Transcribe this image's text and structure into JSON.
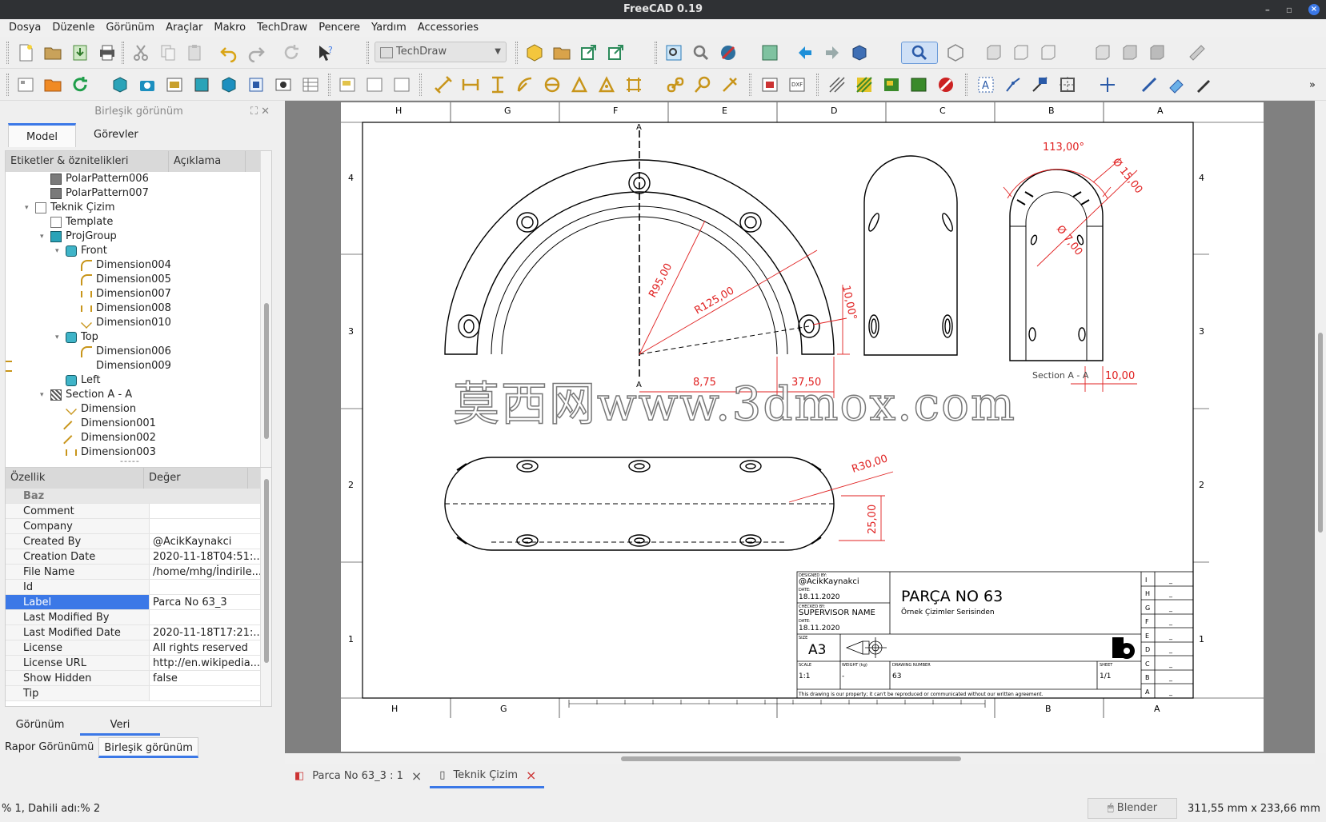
{
  "window": {
    "title": "FreeCAD 0.19"
  },
  "menu": [
    "Dosya",
    "Düzenle",
    "Görünüm",
    "Araçlar",
    "Makro",
    "TechDraw",
    "Pencere",
    "Yardım",
    "Accessories"
  ],
  "toolbar": {
    "workbench": "TechDraw"
  },
  "combo": {
    "title": "Birleşik görünüm",
    "tabs": [
      "Model",
      "Görevler"
    ],
    "tree_headers": [
      "Etiketler & öznitelikleri",
      "Açıklama"
    ],
    "tree": [
      {
        "label": "PolarPattern006",
        "icon": "pattern-icon"
      },
      {
        "label": "PolarPattern007",
        "icon": "pattern-icon"
      },
      {
        "label": "Teknik Çizim",
        "icon": "page-icon"
      },
      {
        "label": "Template",
        "icon": "template-icon"
      },
      {
        "label": "ProjGroup",
        "icon": "projgroup-icon"
      },
      {
        "label": "Front",
        "icon": "view-icon"
      },
      {
        "label": "Dimension004",
        "icon": "radius-dimension-icon"
      },
      {
        "label": "Dimension005",
        "icon": "radius-dimension-icon"
      },
      {
        "label": "Dimension007",
        "icon": "horizontal-dimension-icon"
      },
      {
        "label": "Dimension008",
        "icon": "horizontal-dimension-icon"
      },
      {
        "label": "Dimension010",
        "icon": "angle-dimension-icon"
      },
      {
        "label": "Top",
        "icon": "view-icon"
      },
      {
        "label": "Dimension006",
        "icon": "radius-dimension-icon"
      },
      {
        "label": "Dimension009",
        "icon": "vertical-dimension-icon"
      },
      {
        "label": "Left",
        "icon": "view-icon"
      },
      {
        "label": "Section A - A",
        "icon": "section-icon"
      },
      {
        "label": "Dimension",
        "icon": "angle-dimension-icon"
      },
      {
        "label": "Dimension001",
        "icon": "length-dimension-icon"
      },
      {
        "label": "Dimension002",
        "icon": "length-dimension-icon"
      },
      {
        "label": "Dimension003",
        "icon": "horizontal-dimension-icon"
      }
    ],
    "prop_headers": [
      "Özellik",
      "Değer"
    ],
    "prop_group": "Baz",
    "properties": [
      {
        "key": "Comment",
        "value": ""
      },
      {
        "key": "Company",
        "value": ""
      },
      {
        "key": "Created By",
        "value": "@AcikKaynakci"
      },
      {
        "key": "Creation Date",
        "value": "2020-11-18T04:51:..."
      },
      {
        "key": "File Name",
        "value": "/home/mhg/İndirile..."
      },
      {
        "key": "Id",
        "value": ""
      },
      {
        "key": "Label",
        "value": "Parca No 63_3"
      },
      {
        "key": "Last Modified By",
        "value": ""
      },
      {
        "key": "Last Modified Date",
        "value": "2020-11-18T17:21:..."
      },
      {
        "key": "License",
        "value": "All rights reserved"
      },
      {
        "key": "License URL",
        "value": "http://en.wikipedia...."
      },
      {
        "key": "Show Hidden",
        "value": "false"
      },
      {
        "key": "Tip",
        "value": ""
      }
    ],
    "view_tabs": [
      "Görünüm",
      "Veri"
    ],
    "bottom_tabs": [
      "Rapor Görünümü",
      "Birleşik görünüm"
    ]
  },
  "drawing": {
    "columns_top": [
      "H",
      "G",
      "F",
      "E",
      "D",
      "C",
      "B",
      "A"
    ],
    "columns_bottom": [
      "H",
      "G",
      "B",
      "A"
    ],
    "rows": [
      "4",
      "3",
      "2",
      "1"
    ],
    "dims": {
      "r95": "R95,00",
      "r125": "R125,00",
      "d10": "10,00°",
      "d875": "8,75",
      "d3750": "37,50",
      "a113": "113,00°",
      "o15": "Ø 15,00",
      "o7": "Ø 7,00",
      "sec": "Section A - A",
      "d10b": "10,00",
      "r30": "R30,00",
      "d25": "25,00",
      "a_mark": "A"
    },
    "titleblock": {
      "designed_lbl": "DESIGNED BY:",
      "designed": "@AcikKaynakci",
      "date_lbl": "DATE:",
      "date1": "18.11.2020",
      "checked_lbl": "CHECKED BY:",
      "checked": "SUPERVISOR NAME",
      "date2": "18.11.2020",
      "title": "PARÇA NO 63",
      "subtitle": "Örnek Çizimler Serisinden",
      "size_lbl": "SIZE",
      "size": "A3",
      "scale_lbl": "SCALE",
      "scale": "1:1",
      "weight_lbl": "WEIGHT (kg)",
      "weight": "-",
      "drawnum_lbl": "DRAWING NUMBER",
      "drawnum": "63",
      "sheet_lbl": "SHEET",
      "sheet": "1/1",
      "rev_letters": [
        "I",
        "H",
        "G",
        "F",
        "E",
        "D",
        "C",
        "B",
        "A"
      ],
      "rev_dash": "_",
      "footer": "This drawing is our property; it can't be reproduced or communicated without our written agreement."
    }
  },
  "watermark": "莫西网www.3dmox.com",
  "doctabs": [
    {
      "label": "Parca No 63_3 : 1",
      "icon": "freecad-doc-icon"
    },
    {
      "label": "Teknik Çizim",
      "icon": "page-icon"
    }
  ],
  "status": {
    "left": "% 1, Dahili adı:% 2",
    "nav": "Blender",
    "dims": "311,55 mm x 233,66 mm"
  },
  "colors": {
    "accent": "#3b78e7",
    "dim": "#e02020"
  }
}
